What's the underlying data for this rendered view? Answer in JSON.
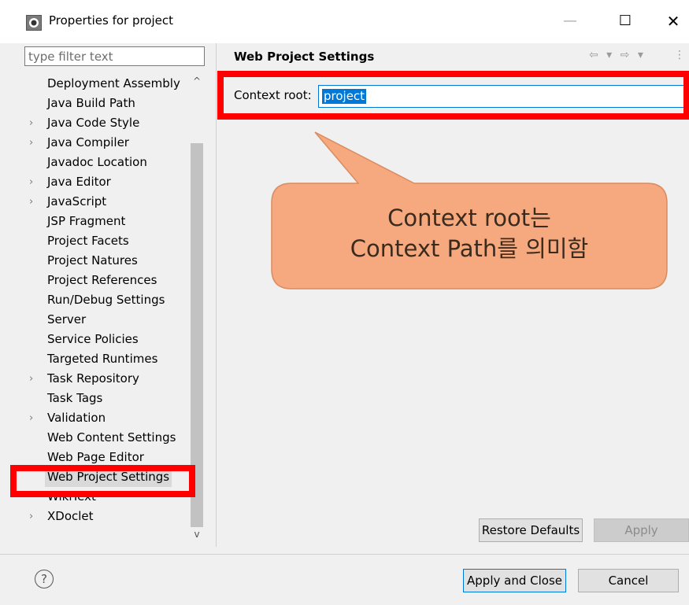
{
  "window": {
    "title": "Properties for project",
    "min_glyph": "—",
    "max_glyph": "☐",
    "close_glyph": "✕"
  },
  "filter": {
    "placeholder": "type filter text",
    "value": ""
  },
  "tree": {
    "items": [
      {
        "label": "Deployment Assembly",
        "expandable": false
      },
      {
        "label": "Java Build Path",
        "expandable": false
      },
      {
        "label": "Java Code Style",
        "expandable": true
      },
      {
        "label": "Java Compiler",
        "expandable": true
      },
      {
        "label": "Javadoc Location",
        "expandable": false
      },
      {
        "label": "Java Editor",
        "expandable": true
      },
      {
        "label": "JavaScript",
        "expandable": true
      },
      {
        "label": "JSP Fragment",
        "expandable": false
      },
      {
        "label": "Project Facets",
        "expandable": false
      },
      {
        "label": "Project Natures",
        "expandable": false
      },
      {
        "label": "Project References",
        "expandable": false
      },
      {
        "label": "Run/Debug Settings",
        "expandable": false
      },
      {
        "label": "Server",
        "expandable": false
      },
      {
        "label": "Service Policies",
        "expandable": false
      },
      {
        "label": "Targeted Runtimes",
        "expandable": false
      },
      {
        "label": "Task Repository",
        "expandable": true
      },
      {
        "label": "Task Tags",
        "expandable": false
      },
      {
        "label": "Validation",
        "expandable": true
      },
      {
        "label": "Web Content Settings",
        "expandable": false
      },
      {
        "label": "Web Page Editor",
        "expandable": false
      },
      {
        "label": "Web Project Settings",
        "expandable": false,
        "selected": true
      },
      {
        "label": "WikiText",
        "expandable": false
      },
      {
        "label": "XDoclet",
        "expandable": true
      }
    ],
    "arrow_glyph": "›",
    "scroll_up_glyph": "^",
    "scroll_down_glyph": "v"
  },
  "page": {
    "title": "Web Project Settings",
    "nav_glyphs": "⇦ ▾ ⇨ ▾",
    "menu_glyph": "⋮",
    "context_root_label": "Context root:",
    "context_root_value": "project"
  },
  "callout": {
    "line1": "Context root는",
    "line2": "Context Path를 의미함",
    "fill": "#f6a97e",
    "stroke": "#d98c5f"
  },
  "buttons": {
    "restore_defaults": "Restore Defaults",
    "apply": "Apply",
    "apply_and_close": "Apply and Close",
    "cancel": "Cancel"
  },
  "help": {
    "glyph": "?"
  },
  "colors": {
    "highlight": "#ff0000",
    "accent": "#0078d7"
  }
}
